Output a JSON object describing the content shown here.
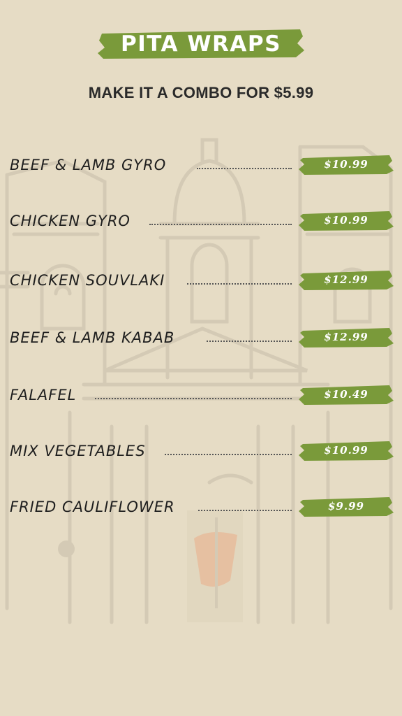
{
  "header": {
    "title": "PITA WRAPS",
    "subtitle": "MAKE IT A COMBO FOR $5.99"
  },
  "menu": {
    "items": [
      {
        "name": "BEEF & LAMB GYRO",
        "price": "$10.99"
      },
      {
        "name": "CHICKEN GYRO",
        "price": "$10.99"
      },
      {
        "name": "CHICKEN SOUVLAKI",
        "price": "$12.99"
      },
      {
        "name": "BEEF & LAMB KABAB",
        "price": "$12.99"
      },
      {
        "name": "FALAFEL",
        "price": "$10.49"
      },
      {
        "name": "MIX VEGETABLES",
        "price": "$10.99"
      },
      {
        "name": "FRIED CAULIFLOWER",
        "price": "$9.99"
      }
    ]
  },
  "colors": {
    "background": "#e6dcc5",
    "accent_green": "#7a9a3a",
    "text": "#1e1e1e",
    "sketch": "#c9c0ad"
  }
}
